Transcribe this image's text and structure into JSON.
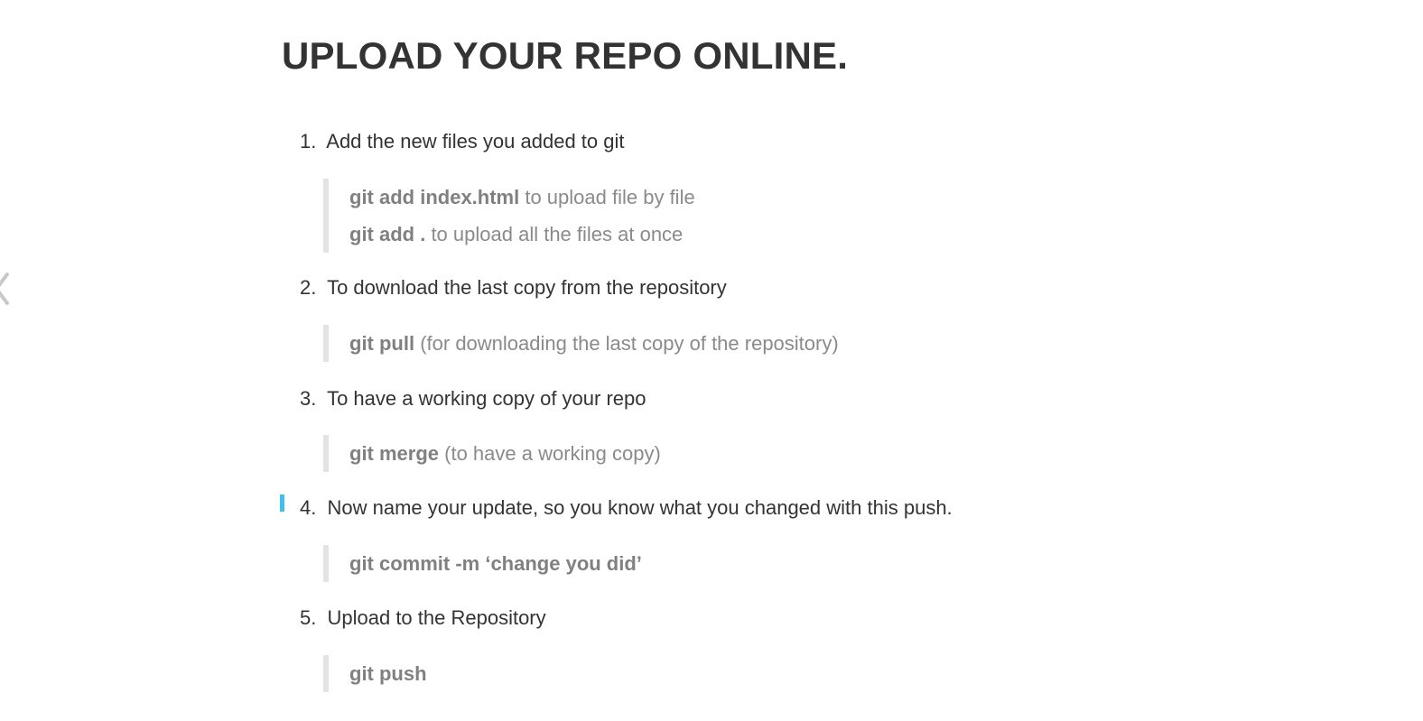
{
  "title": "UPLOAD YOUR REPO ONLINE.",
  "navigation": {
    "prev_icon": "chevron-left-icon"
  },
  "steps": [
    {
      "num": "1.",
      "text": "Add the new files you added to git",
      "lines": [
        {
          "cmd": "git add index.html",
          "note": " to upload file by file"
        },
        {
          "cmd": "git add .",
          "note": " to upload all the files at once"
        }
      ]
    },
    {
      "num": "2.",
      "text": "To download the last copy from the repository",
      "lines": [
        {
          "cmd": "git pull",
          "note": " (for downloading the last copy of the repository)"
        }
      ]
    },
    {
      "num": "3.",
      "text": "To have a working copy of your repo",
      "lines": [
        {
          "cmd": "git merge",
          "note": " (to have a working copy)"
        }
      ]
    },
    {
      "num": "4.",
      "text": "Now name your update, so you know what you changed with this push.",
      "lines": [
        {
          "cmd": "git commit -m ‘change you did’",
          "note": ""
        }
      ]
    },
    {
      "num": "5.",
      "text": "Upload to the Repository",
      "lines": [
        {
          "cmd": "git push",
          "note": ""
        }
      ]
    }
  ],
  "colors": {
    "text": "#333333",
    "quote_text": "#8a8a8a",
    "quote_border": "#e3e3e3",
    "cursor_marker": "#3fbfef"
  }
}
